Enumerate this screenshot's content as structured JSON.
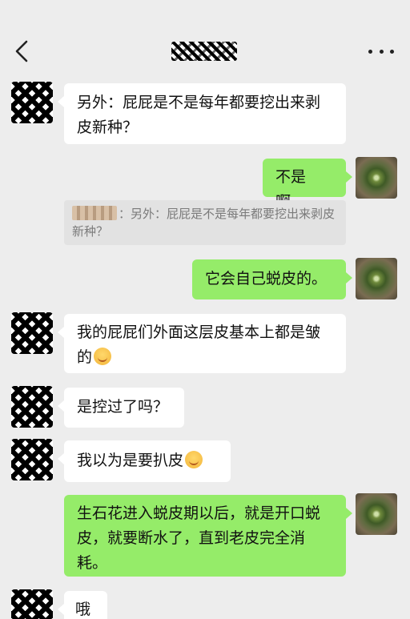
{
  "header": {
    "back_icon": "chevron-left-icon",
    "more_icon": "more-dots-icon"
  },
  "messages": [
    {
      "side": "left",
      "text": "另外：屁屁是不是每年都要挖出来剥皮新种？"
    },
    {
      "side": "right",
      "text": "不是啊。"
    },
    {
      "quote_text": "：另外：屁屁是不是每年都要挖出来剥皮新种？"
    },
    {
      "side": "right",
      "text": "它会自己蜕皮的。"
    },
    {
      "side": "left",
      "text": "我的屁屁们外面这层皮基本上都是皱的"
    },
    {
      "side": "left",
      "text": "是控过了吗？"
    },
    {
      "side": "left",
      "text": "我以为是要扒皮"
    },
    {
      "side": "right",
      "text": "生石花进入蜕皮期以后，就是开口蜕皮，就要断水了，直到老皮完全消耗。"
    },
    {
      "side": "left",
      "text": "哦"
    }
  ],
  "colors": {
    "background": "#ededed",
    "incoming_bubble": "#ffffff",
    "outgoing_bubble": "#95ec69"
  }
}
